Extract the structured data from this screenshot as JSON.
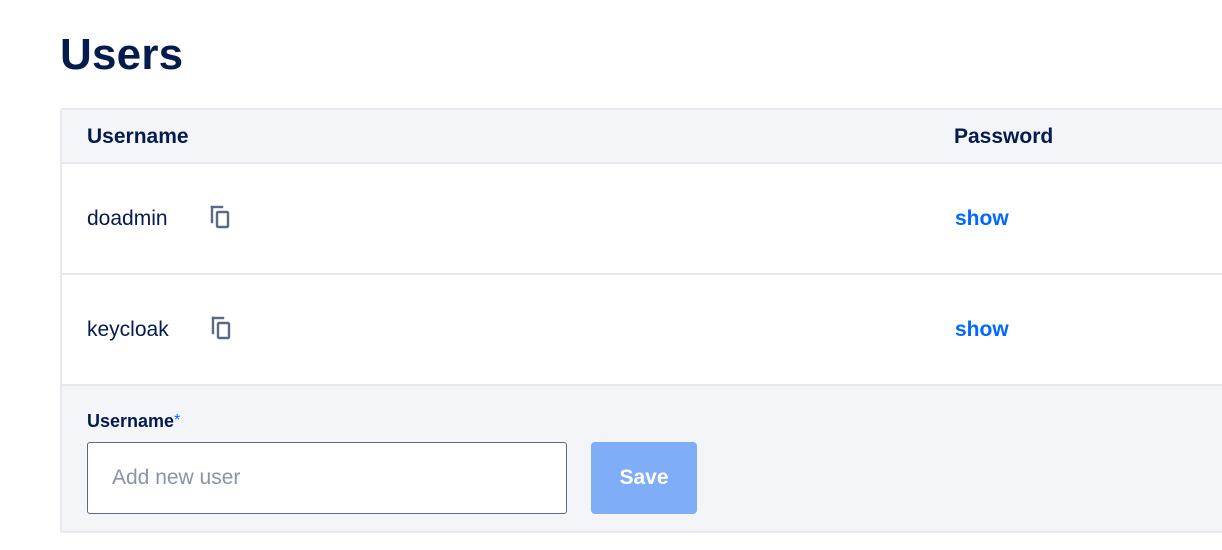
{
  "page": {
    "title": "Users"
  },
  "table": {
    "columns": {
      "username": "Username",
      "password": "Password"
    },
    "rows": [
      {
        "username": "doadmin",
        "password_action": "show",
        "copy_icon": "copy-icon"
      },
      {
        "username": "keycloak",
        "password_action": "show",
        "copy_icon": "copy-icon"
      }
    ]
  },
  "add_user": {
    "label": "Username",
    "required_mark": "*",
    "input_value": "",
    "placeholder": "Add new user",
    "save_label": "Save"
  },
  "colors": {
    "heading": "#031b4e",
    "link": "#0069ff",
    "save_button_disabled": "#80adf8",
    "panel_background": "#f3f5f9",
    "border": "#e5e8ed"
  }
}
